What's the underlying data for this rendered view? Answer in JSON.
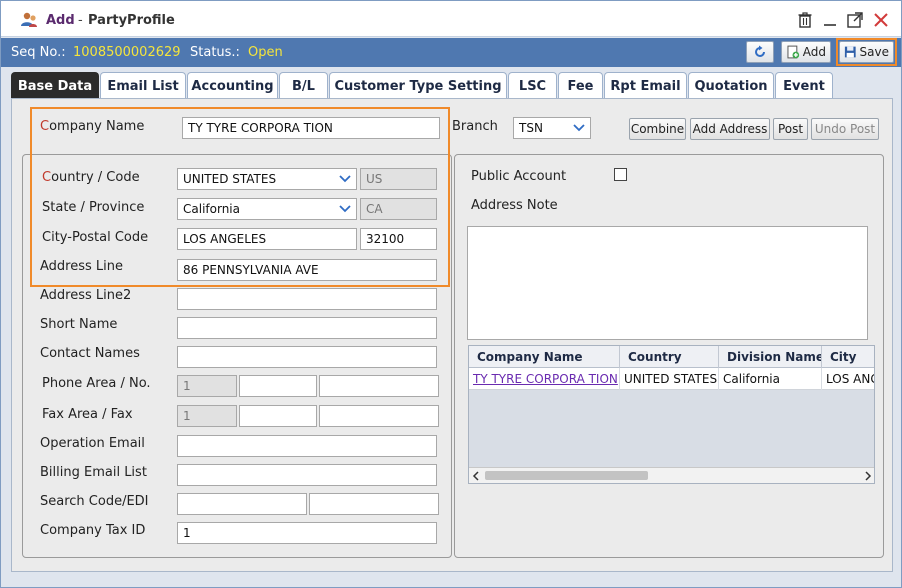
{
  "window": {
    "mode": "Add",
    "separator": "-",
    "title": "PartyProfile"
  },
  "status": {
    "seq_label": "Seq No.:",
    "seq_value": "1008500002629",
    "status_label": "Status.:",
    "status_value": "Open"
  },
  "toolbar": {
    "add_label": "Add",
    "save_label": "Save"
  },
  "tabs": [
    {
      "label": "Base Data"
    },
    {
      "label": "Email List"
    },
    {
      "label": "Accounting"
    },
    {
      "label": "B/L"
    },
    {
      "label": "Customer Type Setting"
    },
    {
      "label": "LSC"
    },
    {
      "label": "Fee"
    },
    {
      "label": "Rpt Email"
    },
    {
      "label": "Quotation"
    },
    {
      "label": "Event"
    }
  ],
  "form": {
    "company_name": {
      "label_first": "C",
      "label_rest": "ompany Name",
      "value": "TY TYRE CORPORA TION"
    },
    "branch": {
      "label": "Branch",
      "value": "TSN"
    },
    "buttons": {
      "combine": "Combine",
      "add_address": "Add Address",
      "post": "Post",
      "undo_post": "Undo Post"
    },
    "country": {
      "label_first": "C",
      "label_rest": "ountry / Code",
      "value": "UNITED STATES",
      "code": "US"
    },
    "state": {
      "label": "State / Province",
      "value": "California",
      "code": "CA"
    },
    "city": {
      "label": "City-Postal Code",
      "value": "LOS ANGELES",
      "postal": "32100"
    },
    "address_line": {
      "label": "Address Line",
      "value": "86 PENNSYLVANIA AVE"
    },
    "address_line2": {
      "label": "Address Line2",
      "value": ""
    },
    "short_name": {
      "label": "Short Name",
      "value": ""
    },
    "contact_names": {
      "label": "Contact Names",
      "value": ""
    },
    "phone": {
      "label": "Phone Area / No.",
      "country_code": "1",
      "area": "",
      "number": ""
    },
    "fax": {
      "label": "Fax Area / Fax",
      "country_code": "1",
      "area": "",
      "number": ""
    },
    "operation_email": {
      "label": "Operation Email",
      "value": ""
    },
    "billing_email": {
      "label": "Billing Email List",
      "value": ""
    },
    "search_code": {
      "label": "Search Code/EDI",
      "value1": "",
      "value2": ""
    },
    "company_tax_id": {
      "label": "Company Tax ID",
      "value": "1"
    }
  },
  "right_panel": {
    "public_account_label": "Public Account",
    "address_note_label": "Address Note",
    "grid": {
      "columns": [
        "Company Name",
        "Country",
        "Division Name",
        "City"
      ],
      "rows": [
        [
          "TY TYRE CORPORA TION",
          "UNITED STATES",
          "California",
          "LOS ANG"
        ]
      ]
    }
  },
  "colors": {
    "status_bar": "#4f78b0",
    "highlight": "#f08a2a",
    "status_value": "#f5e53c",
    "link": "#6a2bb0"
  }
}
